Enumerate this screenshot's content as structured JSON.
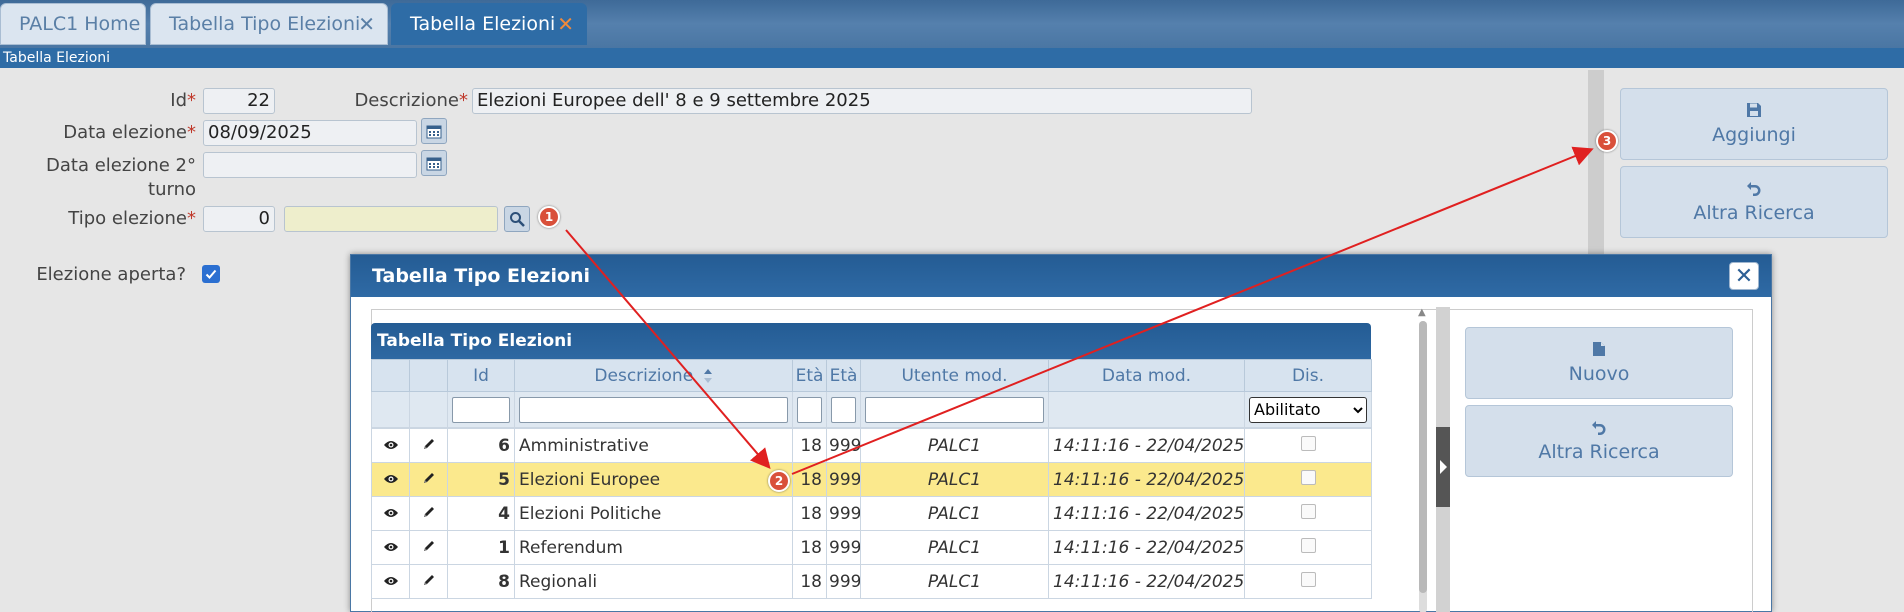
{
  "tabs": [
    {
      "label": "PALC1 Home"
    },
    {
      "label": "Tabella Tipo Elezioni",
      "close": "✕"
    },
    {
      "label": "Tabella Elezioni",
      "close": "✕"
    }
  ],
  "breadcrumb": "Tabella Elezioni",
  "form": {
    "required_mark": "*",
    "id_label": "Id",
    "id_value": "22",
    "descr_label": "Descrizione",
    "descr_value": "Elezioni Europee dell' 8 e 9 settembre 2025",
    "date_label": "Data elezione",
    "date_value": "08/09/2025",
    "date2_label_1": "Data elezione 2°",
    "date2_label_2": "turno",
    "date2_value": "",
    "tipo_label": "Tipo elezione",
    "tipo_value": "0",
    "tipo_descr": "",
    "aperta_label": "Elezione aperta?",
    "aperta_checked": true
  },
  "side_buttons": {
    "add": "Aggiungi",
    "search": "Altra Ricerca"
  },
  "badges": [
    "1",
    "2",
    "3"
  ],
  "dialog": {
    "title": "Tabella Tipo Elezioni",
    "close": "✕",
    "grid_title": "Tabella Tipo Elezioni",
    "columns": [
      "Id",
      "Descrizione",
      "Età",
      "Età",
      "Utente mod.",
      "Data mod.",
      "Dis."
    ],
    "filter_select": "Abilitato",
    "rows": [
      {
        "id": "6",
        "descr": "Amministrative",
        "eta1": "18",
        "eta2": "999",
        "user": "PALC1",
        "date": "14:11:16 - 22/04/2025"
      },
      {
        "id": "5",
        "descr": "Elezioni Europee",
        "eta1": "18",
        "eta2": "999",
        "user": "PALC1",
        "date": "14:11:16 - 22/04/2025"
      },
      {
        "id": "4",
        "descr": "Elezioni Politiche",
        "eta1": "18",
        "eta2": "999",
        "user": "PALC1",
        "date": "14:11:16 - 22/04/2025"
      },
      {
        "id": "1",
        "descr": "Referendum",
        "eta1": "18",
        "eta2": "999",
        "user": "PALC1",
        "date": "14:11:16 - 22/04/2025"
      },
      {
        "id": "8",
        "descr": "Regionali",
        "eta1": "18",
        "eta2": "999",
        "user": "PALC1",
        "date": "14:11:16 - 22/04/2025"
      }
    ],
    "side_buttons": {
      "new": "Nuovo",
      "search": "Altra Ricerca"
    }
  },
  "colors": {
    "accent": "#2e6ca6",
    "selected_row": "#fbe98d",
    "badge": "#d9503a",
    "arrow": "#e02020"
  }
}
